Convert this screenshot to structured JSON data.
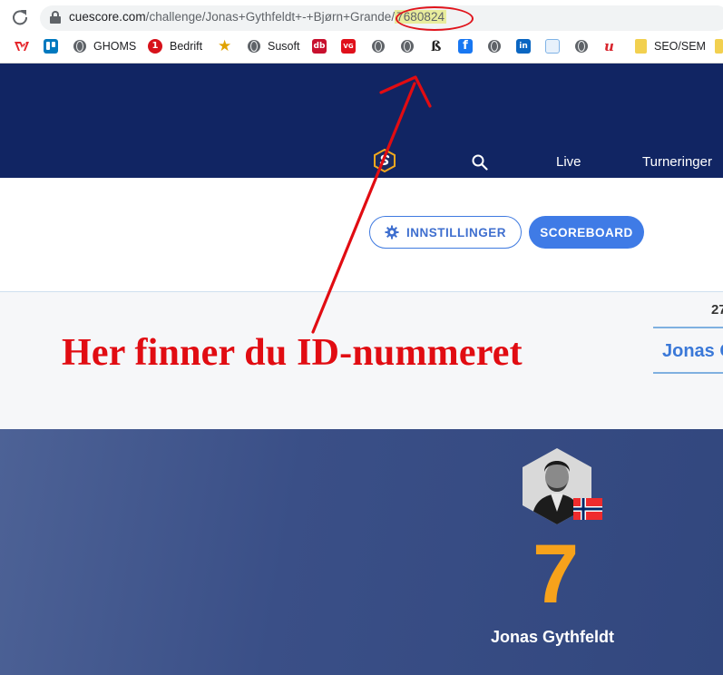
{
  "browser": {
    "url_host": "cuescore.com",
    "url_path": "/challenge/Jonas+Gythfeldt+-+Bjørn+Grande/",
    "url_id": "7680824",
    "bookmarks": [
      {
        "label": "",
        "icon": "vivaldi-icon",
        "color": "#e5262b"
      },
      {
        "label": "",
        "icon": "trello-icon",
        "color": "#0079bf"
      },
      {
        "label": "GHOMS",
        "icon": "globe-icon",
        "color": "#5f6368"
      },
      {
        "label": "Bedrift",
        "icon": "number-one-icon",
        "color": "#d7121b"
      },
      {
        "label": "",
        "icon": "star-icon",
        "color": "#e0a200"
      },
      {
        "label": "Susoft",
        "icon": "globe-icon",
        "color": "#5f6368"
      },
      {
        "label": "",
        "icon": "db-icon",
        "color": "#c8102e"
      },
      {
        "label": "",
        "icon": "vg-icon",
        "color": "#e0111b"
      },
      {
        "label": "",
        "icon": "globe-icon",
        "color": "#5f6368"
      },
      {
        "label": "",
        "icon": "globe-icon",
        "color": "#5f6368"
      },
      {
        "label": "",
        "icon": "gothic-letter-icon",
        "color": "#222222"
      },
      {
        "label": "",
        "icon": "facebook-icon",
        "color": "#1877f2"
      },
      {
        "label": "",
        "icon": "globe-icon",
        "color": "#5f6368"
      },
      {
        "label": "",
        "icon": "linkedin-icon",
        "color": "#0a66c2"
      },
      {
        "label": "",
        "icon": "calendar-icon",
        "color": "#7fb3e6"
      },
      {
        "label": "",
        "icon": "globe-icon",
        "color": "#5f6368"
      },
      {
        "label": "",
        "icon": "u-icon",
        "color": "#d8262e"
      },
      {
        "label": "SEO/SEM",
        "icon": "folder-icon",
        "color": "#f2d04f"
      }
    ]
  },
  "site": {
    "nav": {
      "live": "Live",
      "tournaments": "Turneringer"
    },
    "buttons": {
      "settings": "INNSTILLINGER",
      "scoreboard": "SCOREBOARD"
    },
    "date_fragment": "27",
    "player_tab": "Jonas G",
    "player": {
      "name": "Jonas Gythfeldt",
      "score": "7",
      "country": "Norway"
    }
  },
  "annotation": {
    "text": "Her finner du ID-nummeret",
    "color": "#e10c12"
  },
  "colors": {
    "header": "#112563",
    "accent": "#3f7be6",
    "score": "#f7a21b"
  }
}
